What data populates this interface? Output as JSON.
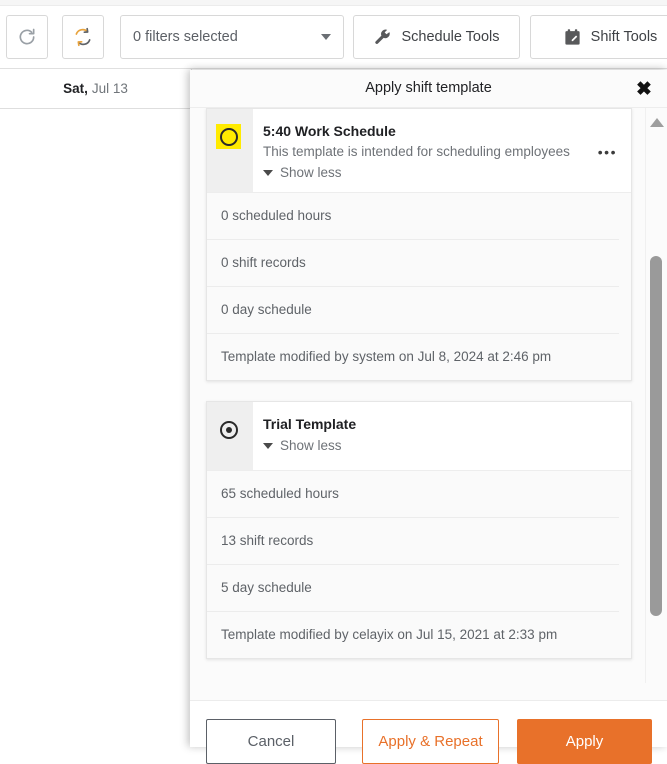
{
  "toolbar": {
    "refresh_button": {
      "icon": "refresh-icon",
      "label": ""
    },
    "sync_button": {
      "icon": "sync-icon",
      "label": ""
    },
    "filters": {
      "value": "0 filters selected",
      "icon": "chevron-down-icon"
    },
    "schedule_tools": {
      "label": "Schedule Tools",
      "icon": "wrench-icon"
    },
    "shift_tools": {
      "label": "Shift Tools",
      "icon": "calendar-edit-icon"
    }
  },
  "grid": {
    "day_column": {
      "dow": "Sat,",
      "date": "Jul 13"
    }
  },
  "modal": {
    "title": "Apply shift template",
    "close_icon": "close-icon",
    "templates": [
      {
        "name": "5:40 Work Schedule",
        "description": "This template is intended for scheduling employees",
        "selected": false,
        "radio_highlighted": true,
        "toggle_label": "Show less",
        "menu_icon": "kebab-menu-icon",
        "details": [
          "0 scheduled hours",
          "0 shift records",
          "0 day schedule",
          "Template modified by system on Jul 8, 2024 at 2:46 pm"
        ]
      },
      {
        "name": "Trial Template",
        "description": "",
        "selected": true,
        "radio_highlighted": false,
        "toggle_label": "Show less",
        "menu_icon": "",
        "details": [
          "65 scheduled hours",
          "13 shift records",
          "5 day schedule",
          "Template modified by celayix on Jul 15, 2021 at 2:33 pm"
        ]
      }
    ],
    "scrollbar": {
      "up_icon": "scroll-up-arrow-icon",
      "down_icon": "scroll-down-arrow-icon"
    },
    "footer": {
      "cancel_label": "Cancel",
      "apply_repeat_label": "Apply & Repeat",
      "apply_label": "Apply"
    }
  },
  "colors": {
    "accent_orange": "#e8712a",
    "highlight_yellow": "#ffeb00",
    "text_dark": "#202124",
    "text_muted": "#6e7277"
  }
}
